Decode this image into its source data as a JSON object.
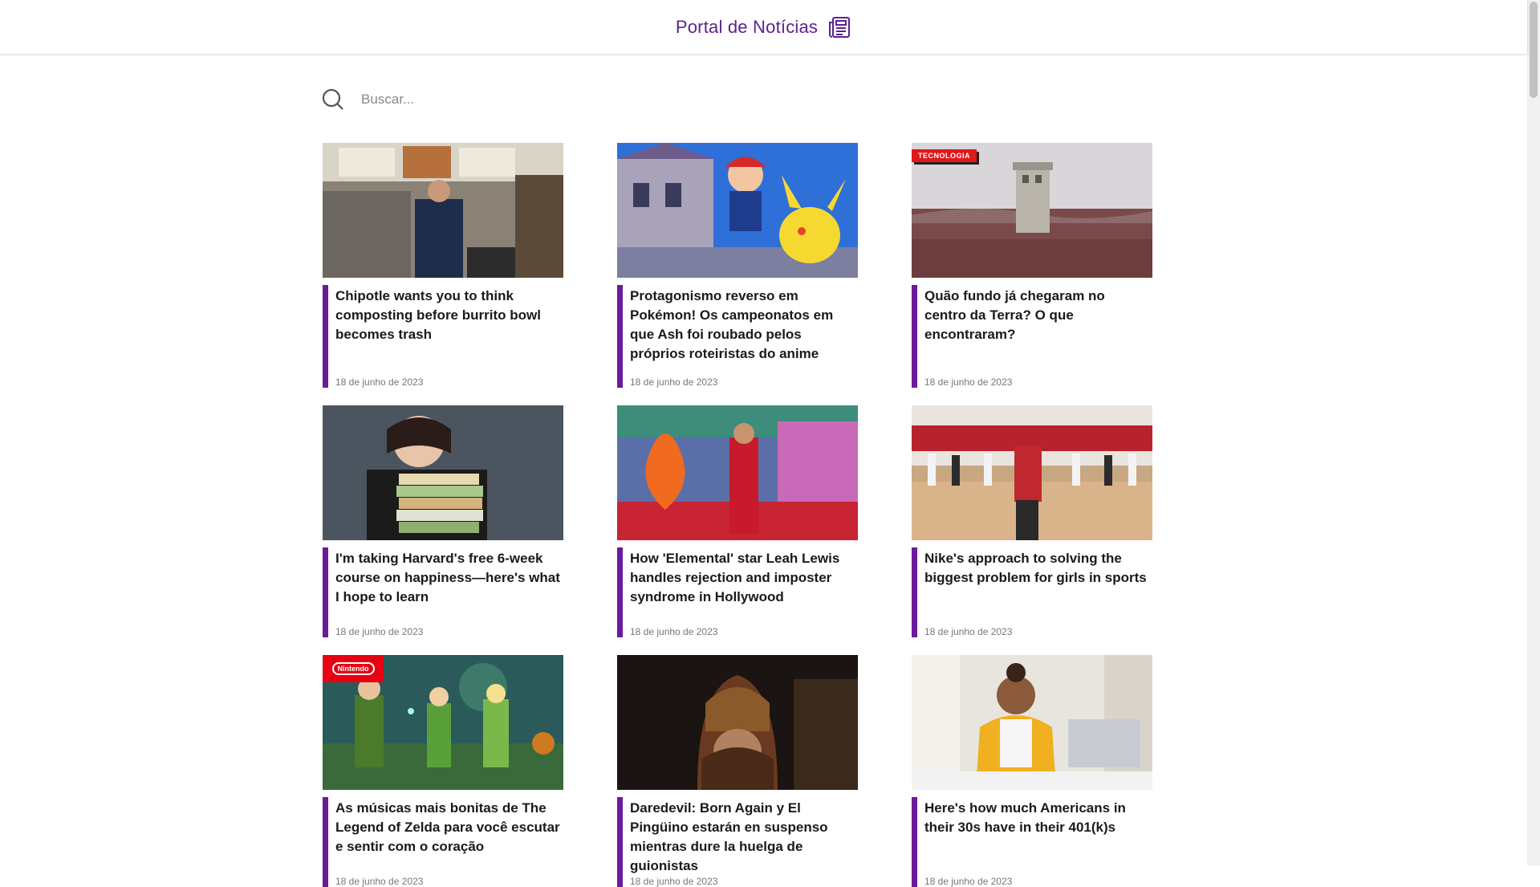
{
  "header": {
    "title": "Portal de Notícias",
    "icon": "newspaper-icon",
    "accent": "#5b2290"
  },
  "search": {
    "placeholder": "Buscar...",
    "value": ""
  },
  "articles": [
    {
      "title": "Chipotle wants you to think composting before burrito bowl becomes trash",
      "date": "18 de junho de 2023"
    },
    {
      "title": "Protagonismo reverso em Pokémon! Os campeonatos em que Ash foi roubado pelos próprios roteiristas do anime",
      "date": "18 de junho de 2023"
    },
    {
      "title": "Quão fundo já chegaram no centro da Terra? O que encontraram?",
      "date": "18 de junho de 2023",
      "badge": "TECNOLOGIA"
    },
    {
      "title": "I'm taking Harvard's free 6-week course on happiness—here's what I hope to learn",
      "date": "18 de junho de 2023"
    },
    {
      "title": "How 'Elemental' star Leah Lewis handles rejection and imposter syndrome in Hollywood",
      "date": "18 de junho de 2023"
    },
    {
      "title": "Nike's approach to solving the biggest problem for girls in sports",
      "date": "18 de junho de 2023"
    },
    {
      "title": "As músicas mais bonitas de The Legend of Zelda para você escutar e sentir com o coração",
      "date": "18 de junho de 2023",
      "badge": "Nintendo"
    },
    {
      "title": "Daredevil: Born Again y El Pingüino estarán en suspenso mientras dure la huelga de guionistas",
      "date": "18 de junho de 2023"
    },
    {
      "title": "Here's how much Americans in their 30s have in their 401(k)s",
      "date": "18 de junho de 2023"
    }
  ],
  "colors": {
    "card_accent": "#6a1b9a",
    "badge_red": "#e01818"
  }
}
